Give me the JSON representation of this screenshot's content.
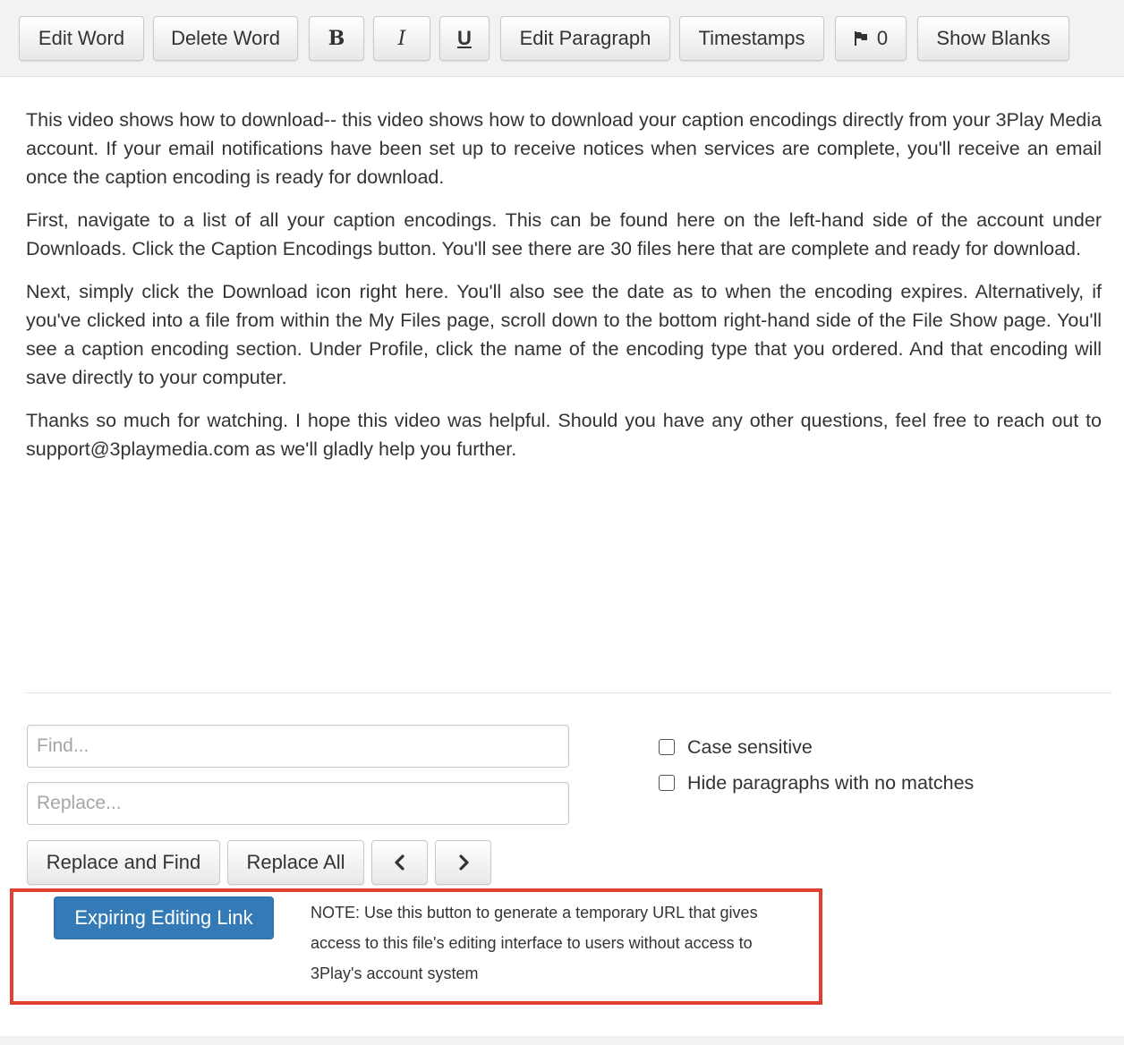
{
  "toolbar": {
    "edit_word": "Edit Word",
    "delete_word": "Delete Word",
    "bold": "B",
    "italic": "I",
    "underline": "U",
    "edit_paragraph": "Edit Paragraph",
    "timestamps": "Timestamps",
    "flag_count": "0",
    "flag_icon": "flag-icon",
    "show_blanks": "Show Blanks"
  },
  "transcript": {
    "paragraphs": [
      "This video shows how to download-- this video shows how to download your caption encodings directly from your 3Play Media account. If your email notifications have been set up to receive notices when services are complete, you'll receive an email once the caption encoding is ready for download.",
      "First, navigate to a list of all your caption encodings. This can be found here on the left-hand side of the account under Downloads. Click the Caption Encodings button. You'll see there are 30 files here that are complete and ready for download.",
      "Next, simply click the Download icon right here. You'll also see the date as to when the encoding expires. Alternatively, if you've clicked into a file from within the My Files page, scroll down to the bottom right-hand side of the File Show page. You'll see a caption encoding section. Under Profile, click the name of the encoding type that you ordered. And that encoding will save directly to your computer.",
      "Thanks so much for watching. I hope this video was helpful. Should you have any other questions, feel free to reach out to support@3playmedia.com as we'll gladly help you further."
    ]
  },
  "find_replace": {
    "find_placeholder": "Find...",
    "find_value": "",
    "replace_placeholder": "Replace...",
    "replace_value": "",
    "case_sensitive_label": "Case sensitive",
    "case_sensitive_checked": false,
    "hide_paragraphs_label": "Hide paragraphs with no matches",
    "hide_paragraphs_checked": false,
    "replace_and_find": "Replace and Find",
    "replace_all": "Replace All",
    "prev_icon": "chevron-left-icon",
    "next_icon": "chevron-right-icon"
  },
  "expiring": {
    "button_label": "Expiring Editing Link",
    "note": "NOTE: Use this button to generate a temporary URL that gives access to this file's editing interface to users without access to 3Play's account system"
  },
  "colors": {
    "primary_button": "#337ab7",
    "highlight_border": "#e0402d",
    "toolbar_bg": "#f2f2f2"
  }
}
